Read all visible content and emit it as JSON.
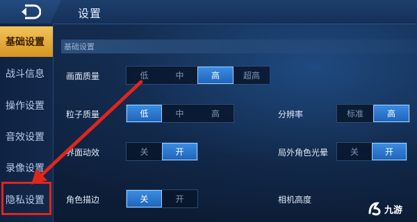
{
  "header": {
    "title": "设置"
  },
  "sidebar": {
    "items": [
      {
        "label": "基础设置",
        "active": true
      },
      {
        "label": "战斗信息",
        "active": false
      },
      {
        "label": "操作设置",
        "active": false
      },
      {
        "label": "音效设置",
        "active": false
      },
      {
        "label": "录像设置",
        "active": false
      },
      {
        "label": "隐私设置",
        "active": false
      }
    ]
  },
  "section": {
    "title": "基础设置"
  },
  "settings": {
    "picture_quality": {
      "label": "画面质量",
      "options": [
        "低",
        "中",
        "高",
        "超高"
      ],
      "selected": "高"
    },
    "particle_quality": {
      "label": "粒子质量",
      "options": [
        "低",
        "中",
        "高"
      ],
      "selected": "低"
    },
    "resolution": {
      "label": "分辨率",
      "options": [
        "标准",
        "高"
      ],
      "selected": "高"
    },
    "ui_animation": {
      "label": "界面动效",
      "options": [
        "关",
        "开"
      ],
      "selected": "开"
    },
    "outside_halo": {
      "label": "局外角色光晕",
      "options": [
        "关",
        "开"
      ],
      "selected": "开"
    },
    "character_outline": {
      "label": "角色描边",
      "options": [
        "关",
        "开"
      ],
      "selected": "关"
    },
    "camera_height": {
      "label": "相机高度"
    }
  },
  "watermark": {
    "text": "九游"
  },
  "colors": {
    "accent_active_tab": "#e5a93a",
    "segment_selected": "#2a78d0",
    "annotation_red": "#e0261b"
  },
  "icons": {
    "back": "back-arrow-icon",
    "watermark": "jiuyou-logo-icon"
  }
}
